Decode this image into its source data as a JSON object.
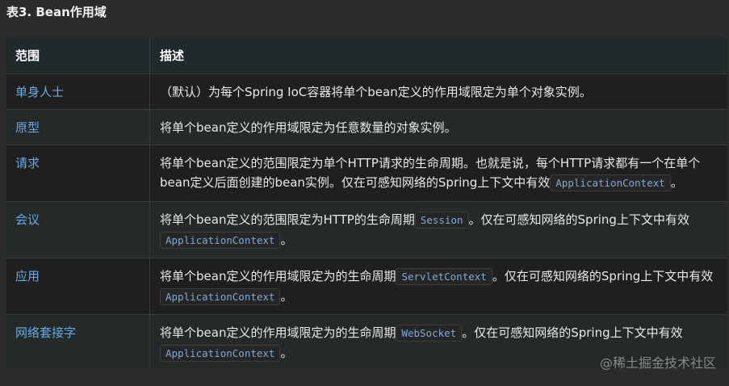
{
  "caption": "表3. Bean作用域",
  "table": {
    "headers": {
      "name": "范围",
      "desc": "描述"
    },
    "rows": [
      {
        "name": "单身人士",
        "desc": "（默认）为每个Spring IoC容器将单个bean定义的作用域限定为单个对象实例。"
      },
      {
        "name": "原型",
        "desc": "将单个bean定义的作用域限定为任意数量的对象实例。"
      },
      {
        "name": "请求",
        "desc_a": "将单个bean定义的范围限定为单个HTTP请求的生命周期。也就是说，每个HTTP请求都有一个在单个bean定义后面创建的bean实例。仅在可感知网络的Spring上下文中有效",
        "code": "ApplicationContext",
        "desc_end": "。"
      },
      {
        "name": "会议",
        "desc_a": "将单个bean定义的范围限定为HTTP的生命周期",
        "code1": "Session",
        "desc_b": "。仅在可感知网络的Spring上下文中有效",
        "code2": "ApplicationContext",
        "desc_end": "。"
      },
      {
        "name": "应用",
        "desc_a": "将单个bean定义的作用域限定为的生命周期",
        "code1": "ServletContext",
        "desc_b": "。仅在可感知网络的Spring上下文中有效",
        "code2": "ApplicationContext",
        "desc_end": "。"
      },
      {
        "name": "网络套接字",
        "desc_a": "将单个bean定义的作用域限定为的生命周期",
        "code1": "WebSocket",
        "desc_b": "。仅在可感知网络的Spring上下文中有效",
        "code2": "ApplicationContext",
        "desc_end": "。"
      }
    ]
  },
  "watermark": "@稀土掘金技术社区",
  "colors": {
    "background": "#2b2b2b",
    "header_bg": "#1f2b2a",
    "link": "#6aa9e6",
    "code_text": "#7fa9d8"
  }
}
